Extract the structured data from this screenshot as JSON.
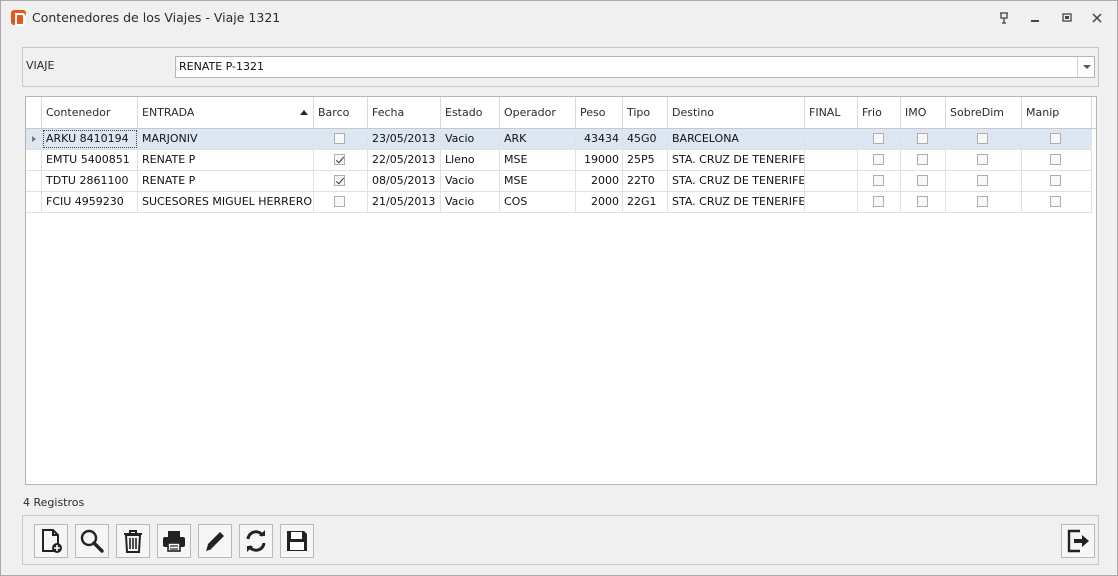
{
  "window": {
    "title": "Contenedores de los Viajes - Viaje 1321"
  },
  "viaje": {
    "label": "VIAJE",
    "value": "RENATE P-1321"
  },
  "grid": {
    "columns": [
      "Contenedor",
      "ENTRADA",
      "Barco",
      "Fecha",
      "Estado",
      "Operador",
      "Peso",
      "Tipo",
      "Destino",
      "FINAL",
      "Frio",
      "IMO",
      "SobreDim",
      "Manip"
    ],
    "sorted_column": "ENTRADA",
    "sort_direction": "ascending",
    "rows": [
      {
        "contenedor": "ARKU 8410194",
        "entrada": "MARJONIV",
        "barco": false,
        "fecha": "23/05/2013",
        "estado": "Vacio",
        "operador": "ARK",
        "peso": "43434",
        "tipo": "45G0",
        "destino": "BARCELONA",
        "final": "",
        "frio": false,
        "imo": false,
        "sobredim": false,
        "manip": false
      },
      {
        "contenedor": "EMTU 5400851",
        "entrada": "RENATE P",
        "barco": true,
        "fecha": "22/05/2013",
        "estado": "Lleno",
        "operador": "MSE",
        "peso": "19000",
        "tipo": "25P5",
        "destino": "STA. CRUZ DE TENERIFE",
        "final": "",
        "frio": false,
        "imo": false,
        "sobredim": false,
        "manip": false
      },
      {
        "contenedor": "TDTU 2861100",
        "entrada": "RENATE P",
        "barco": true,
        "fecha": "08/05/2013",
        "estado": "Vacio",
        "operador": "MSE",
        "peso": "2000",
        "tipo": "22T0",
        "destino": "STA. CRUZ DE TENERIFE",
        "final": "",
        "frio": false,
        "imo": false,
        "sobredim": false,
        "manip": false
      },
      {
        "contenedor": "FCIU 4959230",
        "entrada": "SUCESORES MIGUEL HERRERO",
        "barco": false,
        "fecha": "21/05/2013",
        "estado": "Vacio",
        "operador": "COS",
        "peso": "2000",
        "tipo": "22G1",
        "destino": "STA. CRUZ DE TENERIFE",
        "final": "",
        "frio": false,
        "imo": false,
        "sobredim": false,
        "manip": false
      }
    ]
  },
  "footer": {
    "records": "4 Registros"
  },
  "toolbar": {
    "buttons": [
      "new-document-icon",
      "search-icon",
      "trash-icon",
      "printer-icon",
      "pencil-icon",
      "refresh-icon",
      "save-icon"
    ],
    "exit": "exit-icon"
  },
  "colors": {
    "selected_row": "#dde7f3",
    "app_logo": "#e5561d"
  }
}
